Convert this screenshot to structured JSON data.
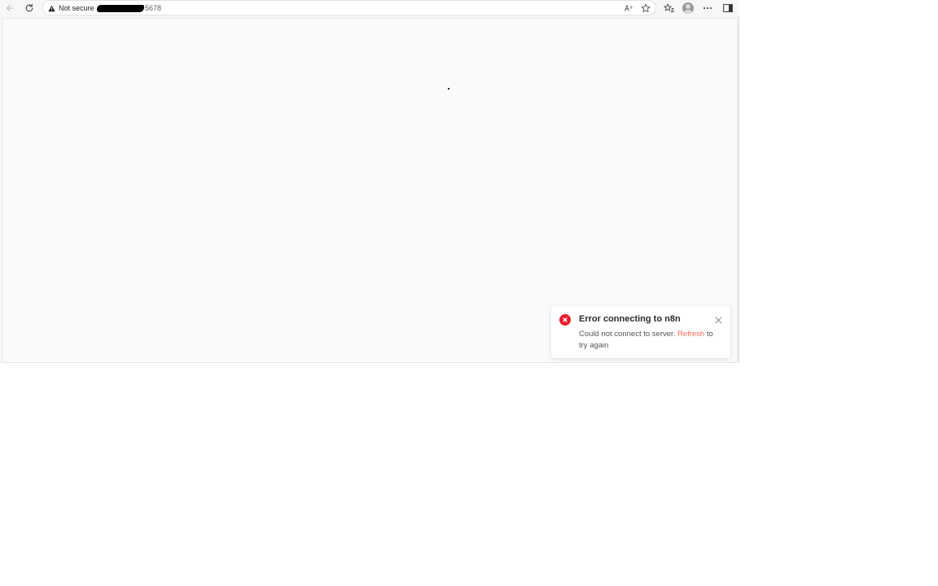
{
  "browser": {
    "security_label": "Not secure",
    "url_visible_suffix": "5678"
  },
  "toast": {
    "title": "Error connecting to n8n",
    "message_before_link": "Could not connect to server. ",
    "link_label": "Refresh",
    "message_after_link": " to try again",
    "icon": "error-circle-icon",
    "accent_color": "#ea1f30",
    "link_color": "#ff6d5a"
  }
}
